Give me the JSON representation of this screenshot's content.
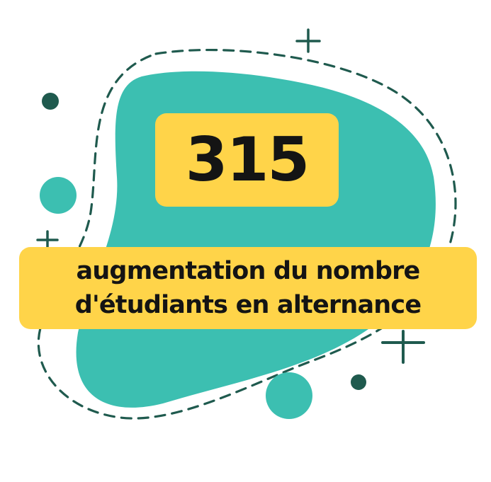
{
  "stat": {
    "value": "315",
    "caption_line1": "augmentation du nombre",
    "caption_line2": "d'étudiants en alternance"
  },
  "colors": {
    "blob": "#3cbfb1",
    "highlight": "#ffd449",
    "dark_accent": "#1f5a4e",
    "text": "#141414"
  }
}
